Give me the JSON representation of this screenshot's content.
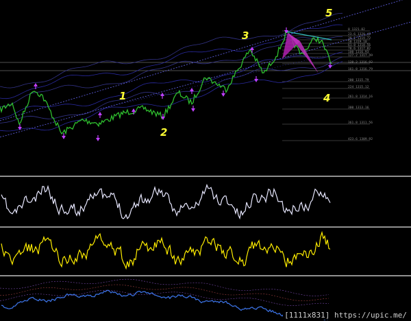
{
  "colors": {
    "background": "#000000",
    "price_line": "#2fbf2f",
    "channel_lines": "#5a5ad6",
    "bands": "#2a2a8a",
    "fib_lines": "#7a7a7a",
    "pattern_fill": "#b020b0",
    "trend_line": "#33c0c0",
    "arrow_markers": "#c040ff",
    "wave_labels": "#ffff33",
    "separator": "#bfbfbf",
    "osc1": "#e8e8ff",
    "osc2": "#ffee00",
    "osc3": "#3a70e0",
    "osc3_guides": "#a04040"
  },
  "wave_labels": [
    "1",
    "2",
    "3",
    "4",
    "5"
  ],
  "fib_levels": [
    "0 1321.02",
    "23.6 1320.40",
    "38.2 1319.72",
    "50 1319.10",
    "61.8 1318.56",
    "78.6 1317.82",
    "100 1316.93",
    "127.2 1317.49",
    "138.2 1316.92",
    "161.8 1316.79",
    "200 1315.79",
    "224 1315.12",
    "261.8 1314.16",
    "300 1313.16",
    "361.8 1311.56",
    "423.6 1309.92"
  ],
  "watermark": {
    "size": "[1111x831]",
    "url": "https://upic.me/"
  }
}
